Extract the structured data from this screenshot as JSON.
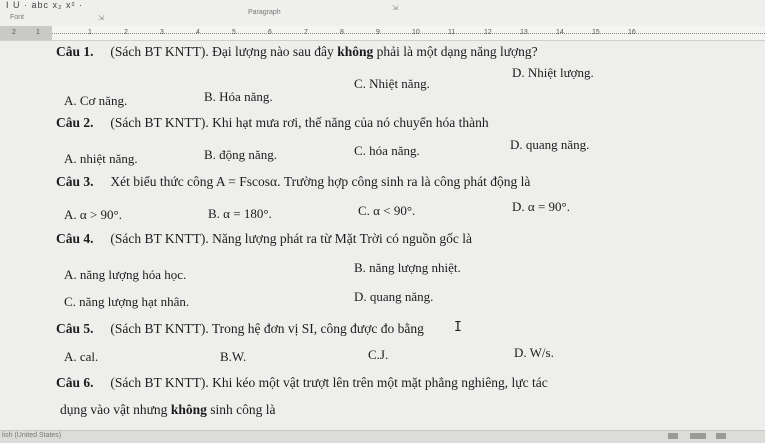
{
  "toolbar": {
    "format_glyphs": "I  U · abc  x₂  x² · ",
    "font_group": "Font",
    "paragraph_group": "Paragraph"
  },
  "ruler": {
    "ticks": [
      "2",
      "1",
      "1",
      "2",
      "3",
      "4",
      "5",
      "6",
      "7",
      "8",
      "9",
      "10",
      "11",
      "12",
      "13",
      "14",
      "15",
      "16"
    ]
  },
  "questions": [
    {
      "num": "Câu 1.",
      "text_a": "(Sách BT KNTT). Đại lượng nào sau đây ",
      "text_b": "không",
      "text_c": " phải là một dạng năng lượng?",
      "options": [
        "A. Cơ năng.",
        "B. Hóa năng.",
        "C. Nhiệt năng.",
        "D. Nhiệt lượng."
      ]
    },
    {
      "num": "Câu 2.",
      "text": "(Sách BT KNTT). Khi hạt mưa rơi, thế năng của nó chuyển hóa thành",
      "options": [
        "A. nhiệt năng.",
        "B. động năng.",
        "C. hóa năng.",
        "D. quang năng."
      ]
    },
    {
      "num": "Câu 3.",
      "text": "Xét biểu thức công A = Fscosα. Trường hợp công sinh ra là công phát động là",
      "options": [
        "A. α > 90°.",
        "B. α = 180°.",
        "C. α < 90°.",
        "D. α = 90°."
      ]
    },
    {
      "num": "Câu 4.",
      "text": "(Sách BT KNTT). Năng lượng phát ra từ Mặt Trời có nguồn gốc là",
      "options": [
        "A. năng lượng hóa học.",
        "B. năng lượng nhiệt.",
        "C. năng lượng hạt nhân.",
        "D. quang năng."
      ]
    },
    {
      "num": "Câu 5.",
      "text": "(Sách BT KNTT). Trong hệ đơn vị SI, công được đo bằng",
      "options": [
        "A. cal.",
        "B.W.",
        "C.J.",
        "D. W/s."
      ]
    },
    {
      "num": "Câu 6.",
      "text": "(Sách BT KNTT). Khi kéo một vật trượt lên trên một mặt phẳng nghiêng, lực tác",
      "text2_a": "dụng vào vật nhưng ",
      "text2_b": "không",
      "text2_c": " sinh công là"
    }
  ],
  "status": {
    "language": "lish (United States)"
  }
}
